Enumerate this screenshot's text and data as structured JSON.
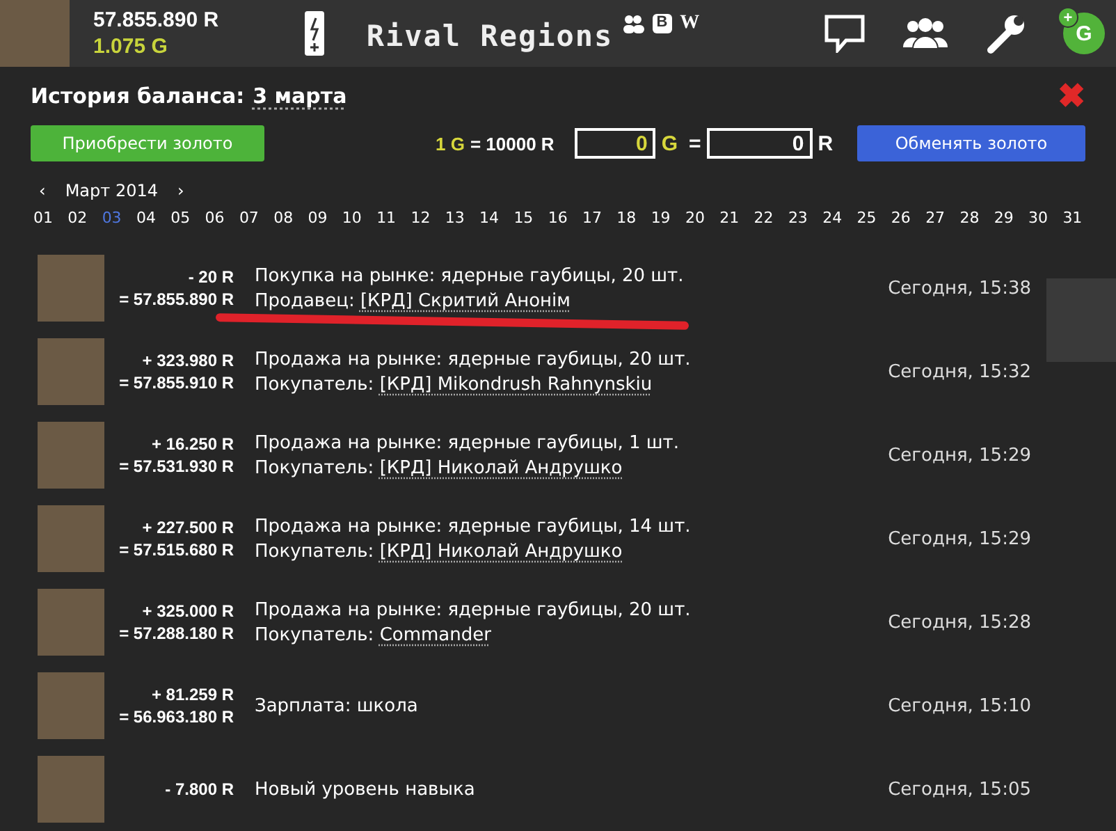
{
  "header": {
    "balance_r": "57.855.890 R",
    "balance_g": "1.075 G",
    "title": "Rival Regions",
    "badges": [
      "В",
      "W"
    ],
    "gold_badge": {
      "plus": "+",
      "letter": "G"
    }
  },
  "modal": {
    "title": "История баланса:",
    "date": "3 марта",
    "close": "✖",
    "exchange": {
      "buy_button": "Приобрести золото",
      "rate_gold": "1 G",
      "rate_rub": "= 10000 R",
      "gold_value": "0",
      "gold_unit": "G",
      "equals": "=",
      "rub_value": "0",
      "rub_unit": "R",
      "exchange_button": "Обменять золото"
    },
    "calendar": {
      "prev": "‹",
      "month": "Март 2014",
      "next": "›",
      "days": [
        {
          "label": "01",
          "selected": false
        },
        {
          "label": "02",
          "selected": false
        },
        {
          "label": "03",
          "selected": true
        },
        {
          "label": "04",
          "selected": false
        },
        {
          "label": "05",
          "selected": false
        },
        {
          "label": "06",
          "selected": false
        },
        {
          "label": "07",
          "selected": false
        },
        {
          "label": "08",
          "selected": false
        },
        {
          "label": "09",
          "selected": false
        },
        {
          "label": "10",
          "selected": false
        },
        {
          "label": "11",
          "selected": false
        },
        {
          "label": "12",
          "selected": false
        },
        {
          "label": "13",
          "selected": false
        },
        {
          "label": "14",
          "selected": false
        },
        {
          "label": "15",
          "selected": false
        },
        {
          "label": "16",
          "selected": false
        },
        {
          "label": "17",
          "selected": false
        },
        {
          "label": "18",
          "selected": false
        },
        {
          "label": "19",
          "selected": false
        },
        {
          "label": "20",
          "selected": false
        },
        {
          "label": "21",
          "selected": false
        },
        {
          "label": "22",
          "selected": false
        },
        {
          "label": "23",
          "selected": false
        },
        {
          "label": "24",
          "selected": false
        },
        {
          "label": "25",
          "selected": false
        },
        {
          "label": "26",
          "selected": false
        },
        {
          "label": "27",
          "selected": false
        },
        {
          "label": "28",
          "selected": false
        },
        {
          "label": "29",
          "selected": false
        },
        {
          "label": "30",
          "selected": false
        },
        {
          "label": "31",
          "selected": false
        }
      ]
    },
    "entries": [
      {
        "change": "- 20 R",
        "balance": "= 57.855.890 R",
        "text": "Покупка на рынке: ядерные гаубицы, 20 шт.",
        "party_label": "Продавец:",
        "party": "[КРД] Скритий Анонім",
        "time": "Сегодня, 15:38"
      },
      {
        "change": "+ 323.980 R",
        "balance": "= 57.855.910 R",
        "text": "Продажа на рынке: ядерные гаубицы, 20 шт.",
        "party_label": "Покупатель:",
        "party": "[КРД] Mikondrush Rahnynskiu",
        "time": "Сегодня, 15:32"
      },
      {
        "change": "+ 16.250 R",
        "balance": "= 57.531.930 R",
        "text": "Продажа на рынке: ядерные гаубицы, 1 шт.",
        "party_label": "Покупатель:",
        "party": "[КРД] Николай Андрушко",
        "time": "Сегодня, 15:29"
      },
      {
        "change": "+ 227.500 R",
        "balance": "= 57.515.680 R",
        "text": "Продажа на рынке: ядерные гаубицы, 14 шт.",
        "party_label": "Покупатель:",
        "party": "[КРД] Николай Андрушко",
        "time": "Сегодня, 15:29"
      },
      {
        "change": "+ 325.000 R",
        "balance": "= 57.288.180 R",
        "text": "Продажа на рынке: ядерные гаубицы, 20 шт.",
        "party_label": "Покупатель:",
        "party": "Commander",
        "time": "Сегодня, 15:28"
      },
      {
        "change": "+ 81.259 R",
        "balance": "= 56.963.180 R",
        "text": "Зарплата: школа",
        "time": "Сегодня, 15:10"
      },
      {
        "change": "- 7.800 R",
        "text": "Новый уровень навыка",
        "time": "Сегодня, 15:05"
      }
    ]
  }
}
